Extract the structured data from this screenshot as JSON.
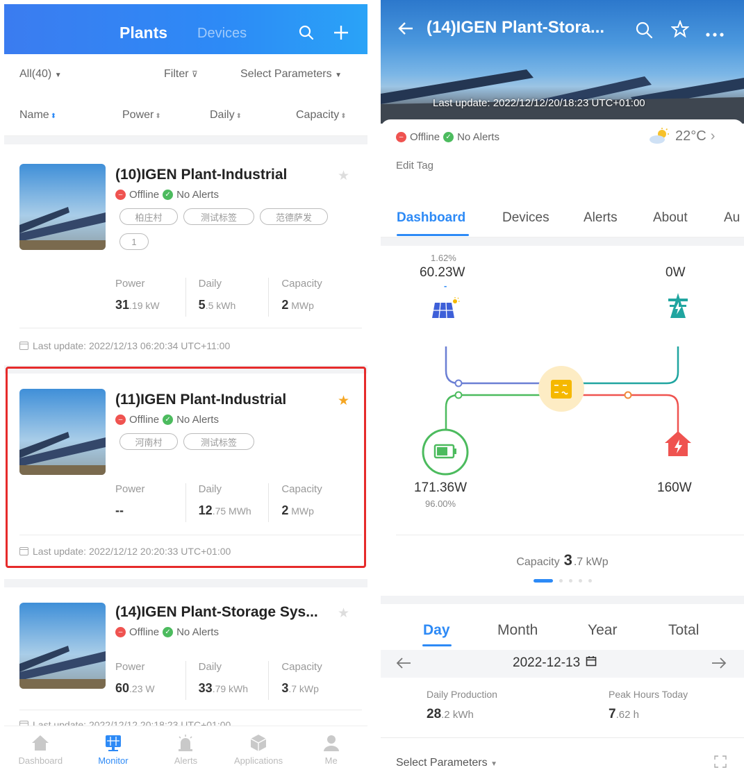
{
  "left": {
    "header": {
      "tab_active": "Plants",
      "tab_inactive": "Devices"
    },
    "filters": {
      "all": "All(40)",
      "filter": "Filter",
      "select_parameters": "Select Parameters"
    },
    "sort": {
      "name": "Name",
      "power": "Power",
      "daily": "Daily",
      "capacity": "Capacity"
    },
    "plants": [
      {
        "name": "(10)IGEN Plant-Industrial",
        "starred": false,
        "offline": "Offline",
        "alerts": "No Alerts",
        "tags": [
          "柏庄村",
          "测试标签",
          "范德萨发",
          "1"
        ],
        "power_label": "Power",
        "power_value": "31",
        "power_unit": ".19 kW",
        "daily_label": "Daily",
        "daily_value": "5",
        "daily_unit": ".5 kWh",
        "capacity_label": "Capacity",
        "capacity_value": "2",
        "capacity_unit": " MWp",
        "last_update": "Last update: 2022/12/13 06:20:34 UTC+11:00"
      },
      {
        "name": "(11)IGEN Plant-Industrial",
        "starred": true,
        "offline": "Offline",
        "alerts": "No Alerts",
        "tags": [
          "河南村",
          "测试标签"
        ],
        "power_label": "Power",
        "power_value": "--",
        "power_unit": "",
        "daily_label": "Daily",
        "daily_value": "12",
        "daily_unit": ".75 MWh",
        "capacity_label": "Capacity",
        "capacity_value": "2",
        "capacity_unit": " MWp",
        "last_update": "Last update: 2022/12/12 20:20:33 UTC+01:00"
      },
      {
        "name": "(14)IGEN Plant-Storage Sys...",
        "starred": false,
        "offline": "Offline",
        "alerts": "No Alerts",
        "tags": [],
        "power_label": "Power",
        "power_value": "60",
        "power_unit": ".23 W",
        "daily_label": "Daily",
        "daily_value": "33",
        "daily_unit": ".79 kWh",
        "capacity_label": "Capacity",
        "capacity_value": "3",
        "capacity_unit": ".7 kWp",
        "last_update": "Last update: 2022/12/12 20:18:23 UTC+01:00"
      }
    ],
    "bottom_nav": [
      "Dashboard",
      "Monitor",
      "Alerts",
      "Applications",
      "Me"
    ],
    "bottom_nav_active": "Monitor"
  },
  "right": {
    "title": "(14)IGEN Plant-Stora...",
    "last_update": "Last update: 2022/12/12/20/18:23 UTC+01:00",
    "offline": "Offline",
    "alerts": "No Alerts",
    "temperature": "22°C",
    "edit_tag": "Edit Tag",
    "tabs": [
      "Dashboard",
      "Devices",
      "Alerts",
      "About",
      "Au"
    ],
    "active_tab": "Dashboard",
    "flow": {
      "pv_percent": "1.62%",
      "pv_power": "60.23W",
      "pv_dash": "-",
      "grid_power": "0W",
      "battery_power": "171.36W",
      "battery_percent": "96.00%",
      "load_power": "160W"
    },
    "capacity_label": "Capacity",
    "capacity_value": "3",
    "capacity_unit": ".7 kWp",
    "period_tabs": [
      "Day",
      "Month",
      "Year",
      "Total"
    ],
    "active_period": "Day",
    "date": "2022-12-13",
    "daily_production_label": "Daily Production",
    "daily_production_value": "28",
    "daily_production_unit": ".2 kWh",
    "peak_hours_label": "Peak Hours Today",
    "peak_hours_value": "7",
    "peak_hours_unit": ".62 h",
    "select_parameters": "Select Parameters",
    "colors": {
      "accent": "#2d8af6",
      "offline": "#ef5350",
      "ok": "#4cbb5e",
      "battery": "#4cbb5e",
      "grid": "#20a5a0",
      "load": "#ef5350",
      "inverter": "#f5b800"
    }
  }
}
